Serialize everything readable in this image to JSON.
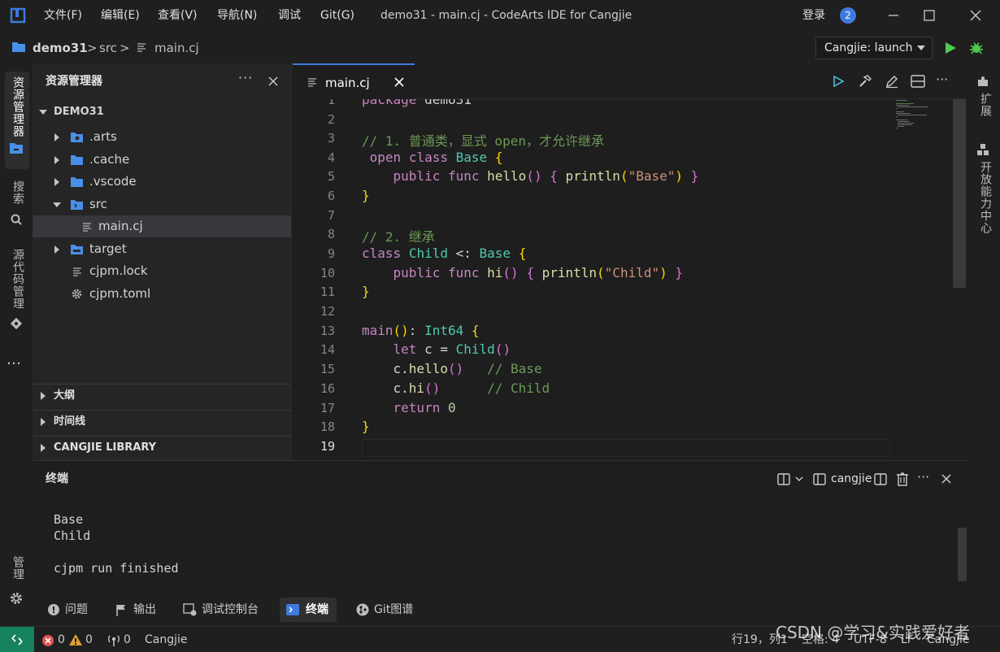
{
  "window": {
    "title": "demo31 - main.cj - CodeArts IDE for Cangjie",
    "login": "登录",
    "notifications": "2"
  },
  "menu": [
    "文件(F)",
    "编辑(E)",
    "查看(V)",
    "导航(N)",
    "调试",
    "Git(G)"
  ],
  "breadcrumb": {
    "project": "demo31",
    "folder": "src",
    "file": "main.cj",
    "sep": ">"
  },
  "run_config": {
    "selected": "Cangjie: launch"
  },
  "activity": {
    "explorer": "资源管理器",
    "search": "搜索",
    "scm": "源代码管理",
    "more": "…",
    "manage": "管理"
  },
  "rightbar": {
    "extensions": "扩展",
    "open_capability": "开放能力中心"
  },
  "sidebar": {
    "title": "资源管理器",
    "root": "DEMO31",
    "items": [
      ".arts",
      ".cache",
      ".vscode",
      "src",
      "main.cj",
      "target",
      "cjpm.lock",
      "cjpm.toml"
    ],
    "sections": [
      "大纲",
      "时间线",
      "CANGJIE LIBRARY"
    ]
  },
  "editor": {
    "tab": "main.cj",
    "lines": [
      "1",
      "2",
      "3",
      "4",
      "5",
      "6",
      "7",
      "8",
      "9",
      "10",
      "11",
      "12",
      "13",
      "14",
      "15",
      "16",
      "17",
      "18",
      "19"
    ]
  },
  "panel": {
    "title": "终端",
    "terminal_name": "cangjie",
    "output": "Base\nChild\n\ncjpm run finished"
  },
  "bottom_tabs": [
    "问题",
    "输出",
    "调试控制台",
    "终端",
    "Git图谱"
  ],
  "status": {
    "errors": "0",
    "warnings": "0",
    "ports": "0",
    "language": "Cangjie",
    "position": "行19，列1",
    "spaces": "空格: 4",
    "encoding": "UTF-8",
    "eol": "LF",
    "lang_mode": "Cangjie"
  },
  "watermark": "CSDN @学习&实践爱好者",
  "colors": {
    "accent": "#3e7ae0",
    "remote": "#16825d",
    "run": "#4ec94e"
  }
}
